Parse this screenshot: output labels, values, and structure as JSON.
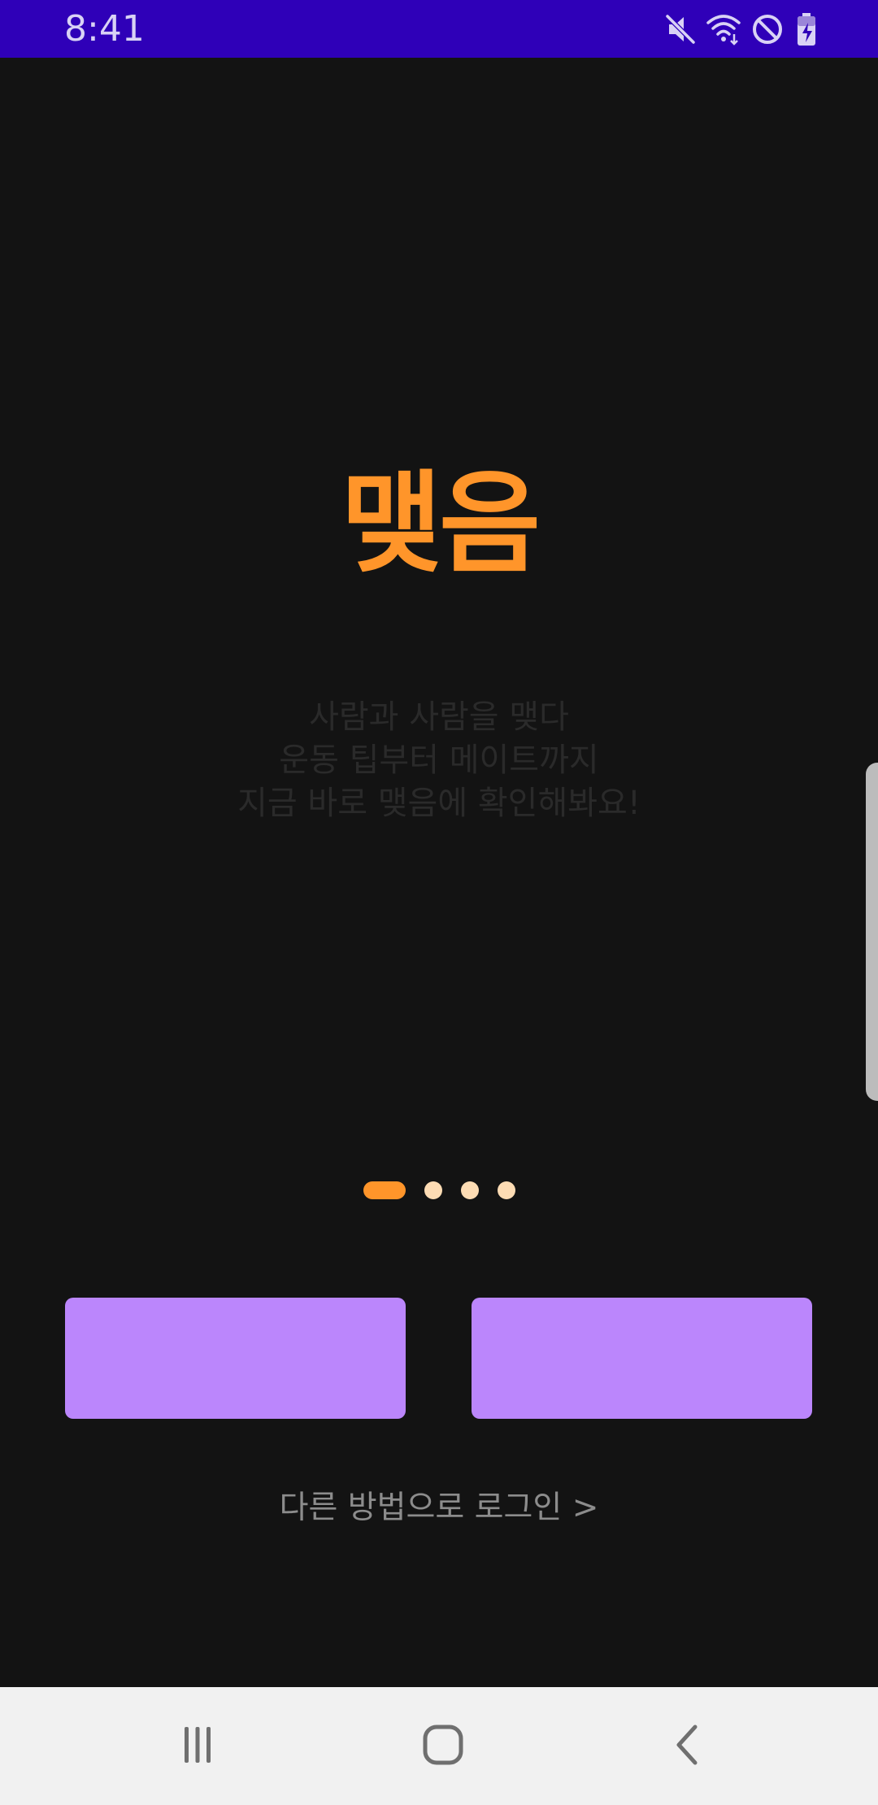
{
  "status_bar": {
    "time": "8:41",
    "icons": [
      "mute-icon",
      "wifi-icon",
      "do-not-disturb-icon",
      "battery-charging-icon"
    ],
    "background": "#2f00b8"
  },
  "app": {
    "logo_text": "맺음",
    "logo_color": "#ff952a",
    "tagline_lines": [
      "사람과 사람을 맺다",
      "운동 팁부터 메이트까지",
      "지금 바로 맺음에 확인해봐요!"
    ]
  },
  "pager": {
    "count": 4,
    "active_index": 0,
    "active_color": "#ff952a",
    "inactive_color": "#fddcb4"
  },
  "buttons": {
    "left_label": "",
    "right_label": "",
    "color": "#bb86fc"
  },
  "other_login": {
    "label": "다른 방법으로 로그인 >"
  },
  "nav_bar": {
    "icons": [
      "recent-apps-icon",
      "home-icon",
      "back-icon"
    ]
  }
}
